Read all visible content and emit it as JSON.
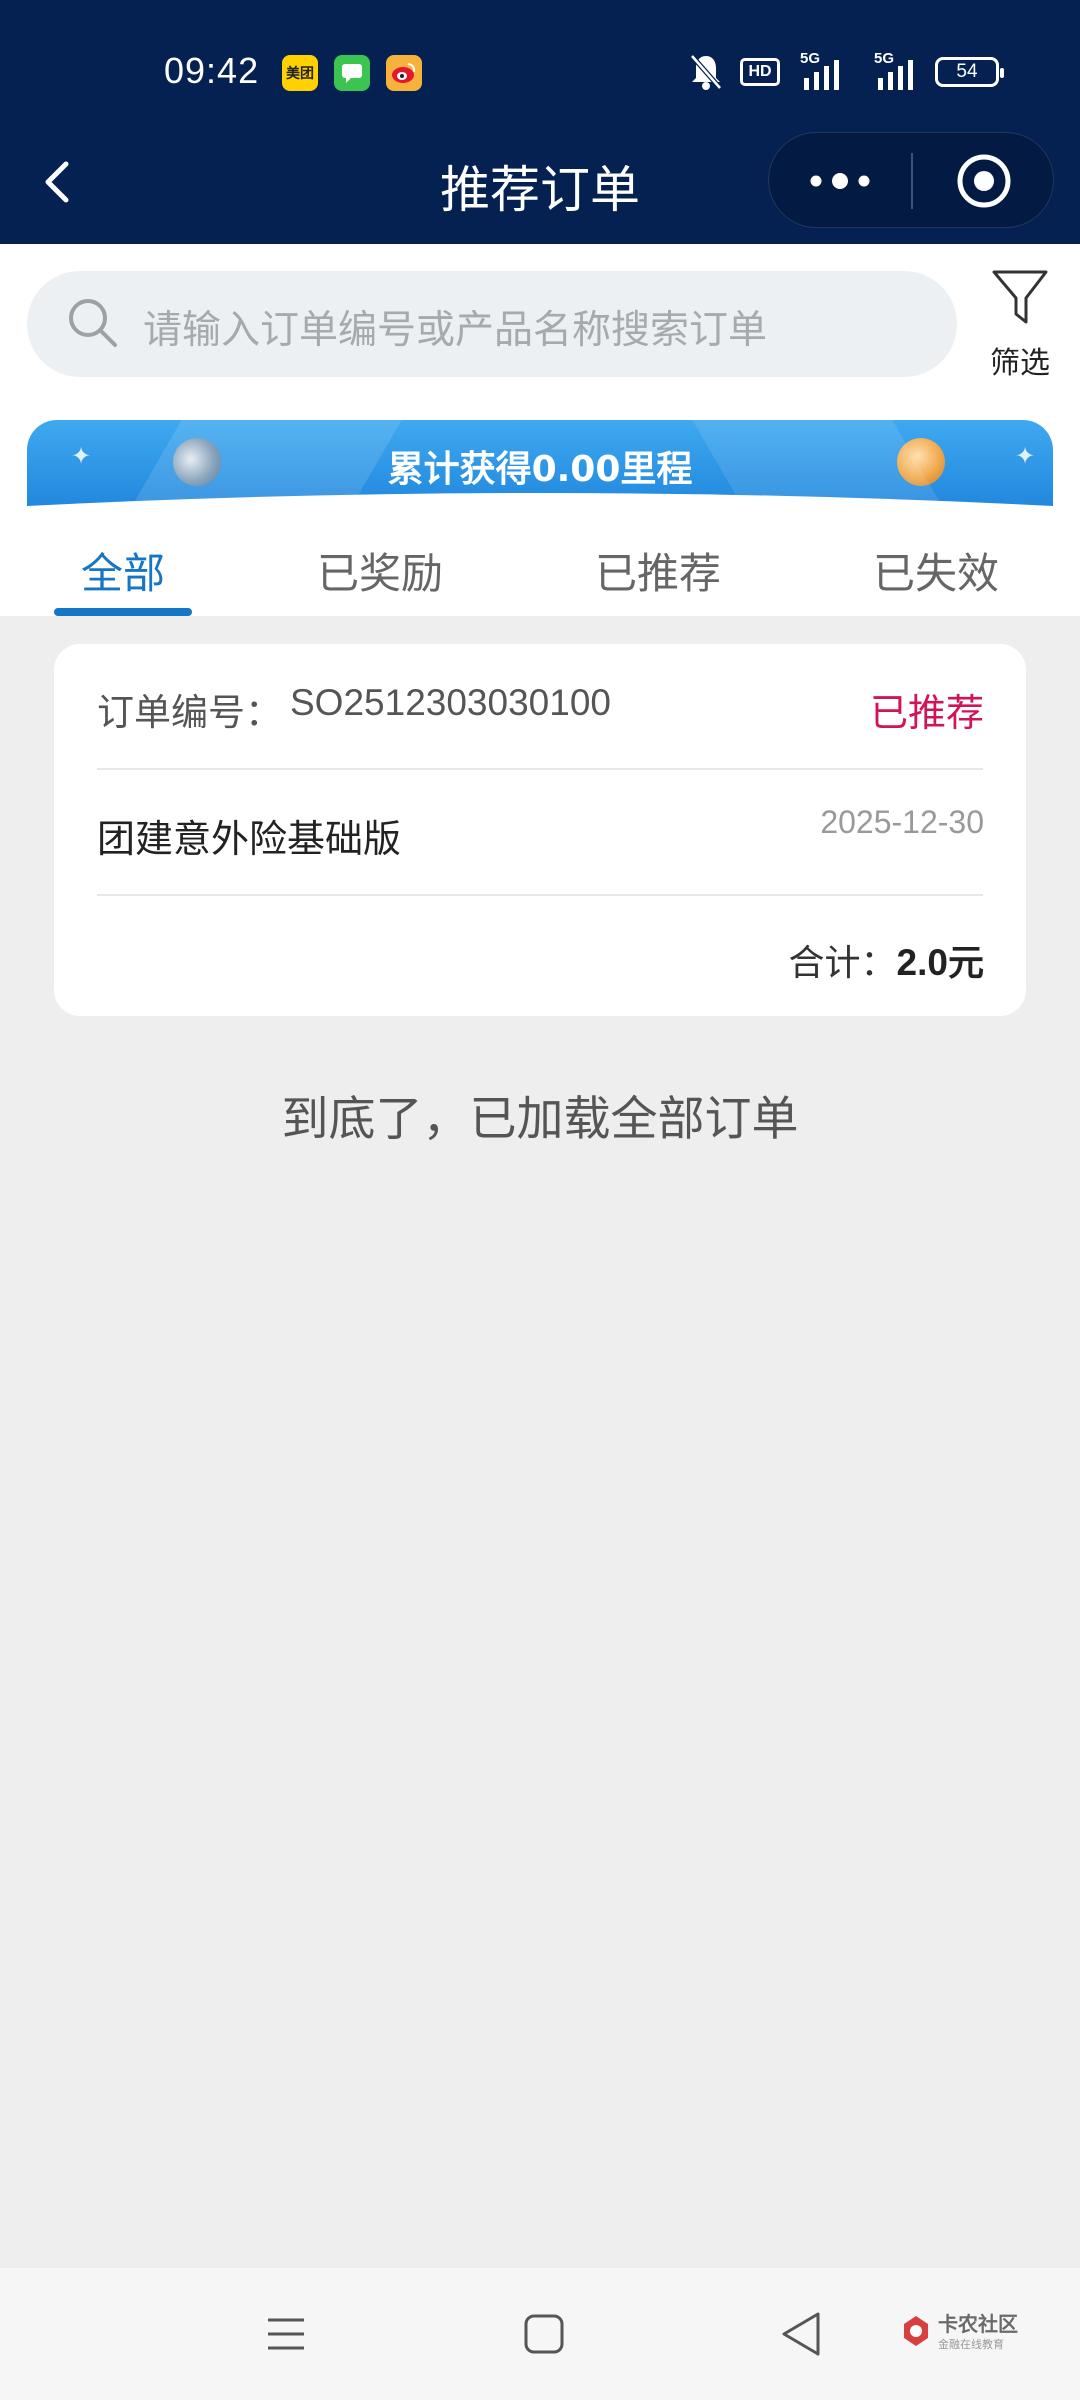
{
  "status_bar": {
    "time": "09:42",
    "apps": [
      {
        "name": "meituan",
        "label": "美团",
        "color": "#ffd100"
      },
      {
        "name": "message",
        "color": "#3bc452"
      },
      {
        "name": "weibo",
        "color": "#f6b23b"
      }
    ],
    "hd_label": "HD",
    "network_1": "5G",
    "network_2": "5G",
    "battery": "54"
  },
  "nav": {
    "title": "推荐订单"
  },
  "search": {
    "placeholder": "请输入订单编号或产品名称搜索订单",
    "filter_label": "筛选"
  },
  "banner": {
    "text": "累计获得0.00里程"
  },
  "tabs": [
    {
      "label": "全部",
      "active": true
    },
    {
      "label": "已奖励",
      "active": false
    },
    {
      "label": "已推荐",
      "active": false
    },
    {
      "label": "已失效",
      "active": false
    }
  ],
  "orders": [
    {
      "order_no_label": "订单编号：",
      "order_no": "SO2512303030100",
      "status": "已推荐",
      "product_name": "团建意外险基础版",
      "date": "2025-12-30",
      "total_label": "合计：",
      "total_value": "2.0",
      "total_unit": "元"
    }
  ],
  "end_text": "到底了，已加载全部订单",
  "watermark": {
    "title": "卡农社区",
    "subtitle": "金融在线教育"
  },
  "colors": {
    "header_bg": "#042152",
    "accent": "#1476c5",
    "status_red": "#d1145a",
    "banner_blue": "#2b93e4"
  }
}
